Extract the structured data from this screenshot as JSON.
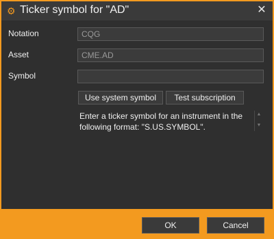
{
  "window": {
    "title": "Ticker symbol for \"AD\"",
    "close_glyph": "✕",
    "icon": "gear-icon"
  },
  "form": {
    "notation": {
      "label": "Notation",
      "value": "CQG"
    },
    "asset": {
      "label": "Asset",
      "value": "CME.AD"
    },
    "symbol": {
      "label": "Symbol",
      "value": ""
    }
  },
  "actions": {
    "use_system_symbol": "Use system symbol",
    "test_subscription": "Test subscription"
  },
  "help_text": "Enter a ticker symbol for an instrument in the following format: \"S.US.SYMBOL\".",
  "footer": {
    "ok": "OK",
    "cancel": "Cancel"
  },
  "colors": {
    "accent": "#f39a1f",
    "background": "#2f2f2f"
  }
}
